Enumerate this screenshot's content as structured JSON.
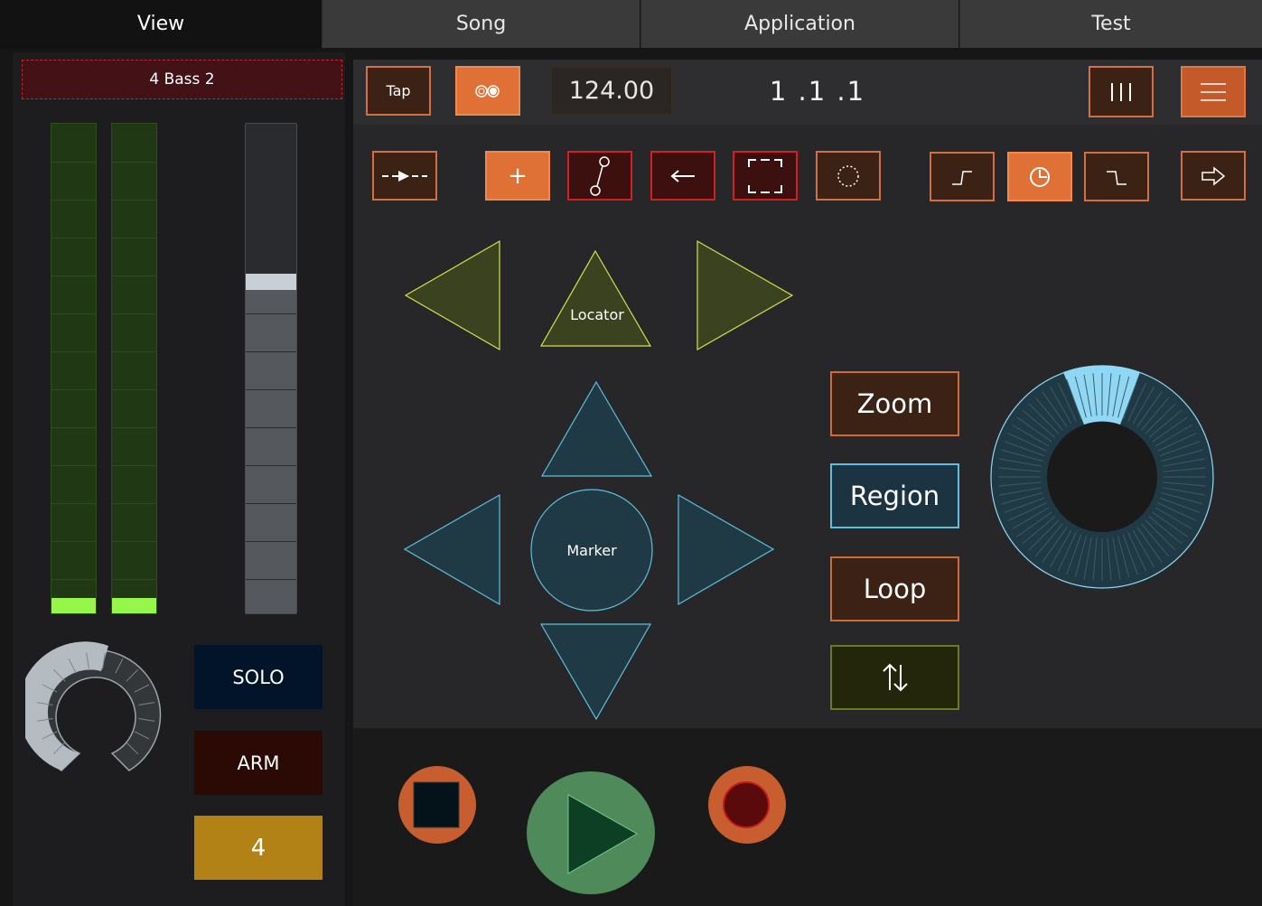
{
  "tabs": [
    {
      "label": "View",
      "active": true
    },
    {
      "label": "Song",
      "active": false
    },
    {
      "label": "Application",
      "active": false
    },
    {
      "label": "Test",
      "active": false
    }
  ],
  "track": {
    "name": "4 Bass 2",
    "solo_label": "SOLO",
    "arm_label": "ARM",
    "number": "4",
    "meter_left_level": 0.03,
    "meter_right_level": 0.03,
    "fader_level": 0.69,
    "pan_knob_level": 0.5
  },
  "toolbar": {
    "tap_label": "Tap",
    "bpm": "124.00",
    "position": "1 .1 .1"
  },
  "locator": {
    "label": "Locator"
  },
  "marker": {
    "label": "Marker"
  },
  "modes": {
    "zoom_label": "Zoom",
    "region_label": "Region",
    "loop_label": "Loop"
  },
  "colors": {
    "accent_orange": "#e07136",
    "locator_yellow": "#3a4220",
    "marker_teal": "#1f3a44",
    "meter_green": "#97f64a",
    "play_green": "#4f8a5a",
    "record_red": "#5a0a0a",
    "jog_blue": "#8fd8f5"
  },
  "icons": {
    "metronome": "double-circle-icon",
    "grid": "three-bars-icon",
    "menu": "hamburger-icon",
    "follow": "dashed-arrow-icon",
    "add": "plus-icon",
    "link": "node-link-icon",
    "back": "left-arrow-icon",
    "select": "bracket-frame-icon",
    "lasso": "dotted-circle-icon",
    "fade_in": "fade-in-icon",
    "clock": "clock-icon",
    "fade_out": "fade-out-icon",
    "forward": "outline-right-arrow-icon",
    "updown": "up-down-arrows-icon"
  }
}
